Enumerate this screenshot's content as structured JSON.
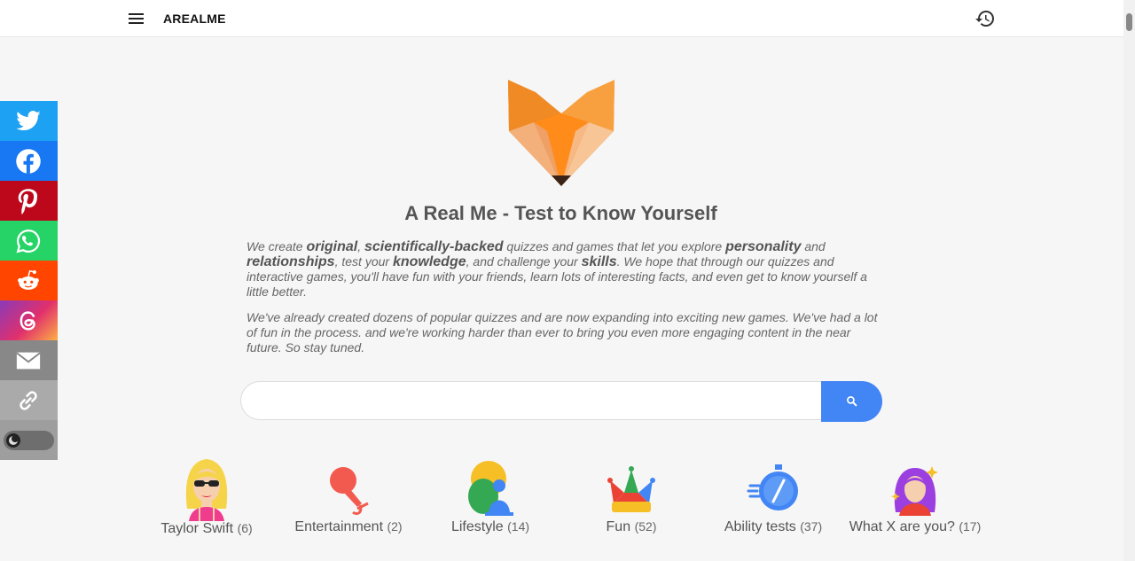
{
  "header": {
    "brand": "AREALME"
  },
  "share": {
    "items": [
      {
        "name": "twitter",
        "color": "#1da1f2"
      },
      {
        "name": "facebook",
        "color": "#1877f2"
      },
      {
        "name": "pinterest",
        "color": "#bd081c"
      },
      {
        "name": "whatsapp",
        "color": "#25d366"
      },
      {
        "name": "reddit",
        "color": "#ff4500"
      },
      {
        "name": "threads",
        "color": "gradient"
      },
      {
        "name": "email",
        "color": "#888888"
      },
      {
        "name": "copy-link",
        "color": "#aaaaaa"
      }
    ]
  },
  "main": {
    "title": "A Real Me - Test to Know Yourself",
    "intro_p2": "We've already created dozens of popular quizzes and are now expanding into exciting new games. We've had a lot of fun in the process. and we're working harder than ever to bring you even more engaging content in the near future. So stay tuned."
  },
  "intro_p1": {
    "t1": "We create ",
    "b1": "original",
    "t2": ", ",
    "b2": "scientifically-backed",
    "t3": " quizzes and games that let you explore ",
    "b3": "personality",
    "t4": " and ",
    "b4": "relationships",
    "t5": ", test your ",
    "b5": "knowledge",
    "t6": ", and challenge your ",
    "b6": "skills",
    "t7": ". We hope that through our quizzes and interactive games, you'll have fun with your friends, learn lots of interesting facts, and even get to know yourself a little better."
  },
  "search": {
    "placeholder": "",
    "value": ""
  },
  "categories": [
    {
      "label": "Taylor Swift",
      "count": "(6)"
    },
    {
      "label": "Entertainment",
      "count": "(2)"
    },
    {
      "label": "Lifestyle",
      "count": "(14)"
    },
    {
      "label": "Fun",
      "count": "(52)"
    },
    {
      "label": "Ability tests",
      "count": "(37)"
    },
    {
      "label": "What X are you?",
      "count": "(17)"
    }
  ],
  "colors": {
    "accent": "#4285f4",
    "fox": "#ff7f00"
  }
}
